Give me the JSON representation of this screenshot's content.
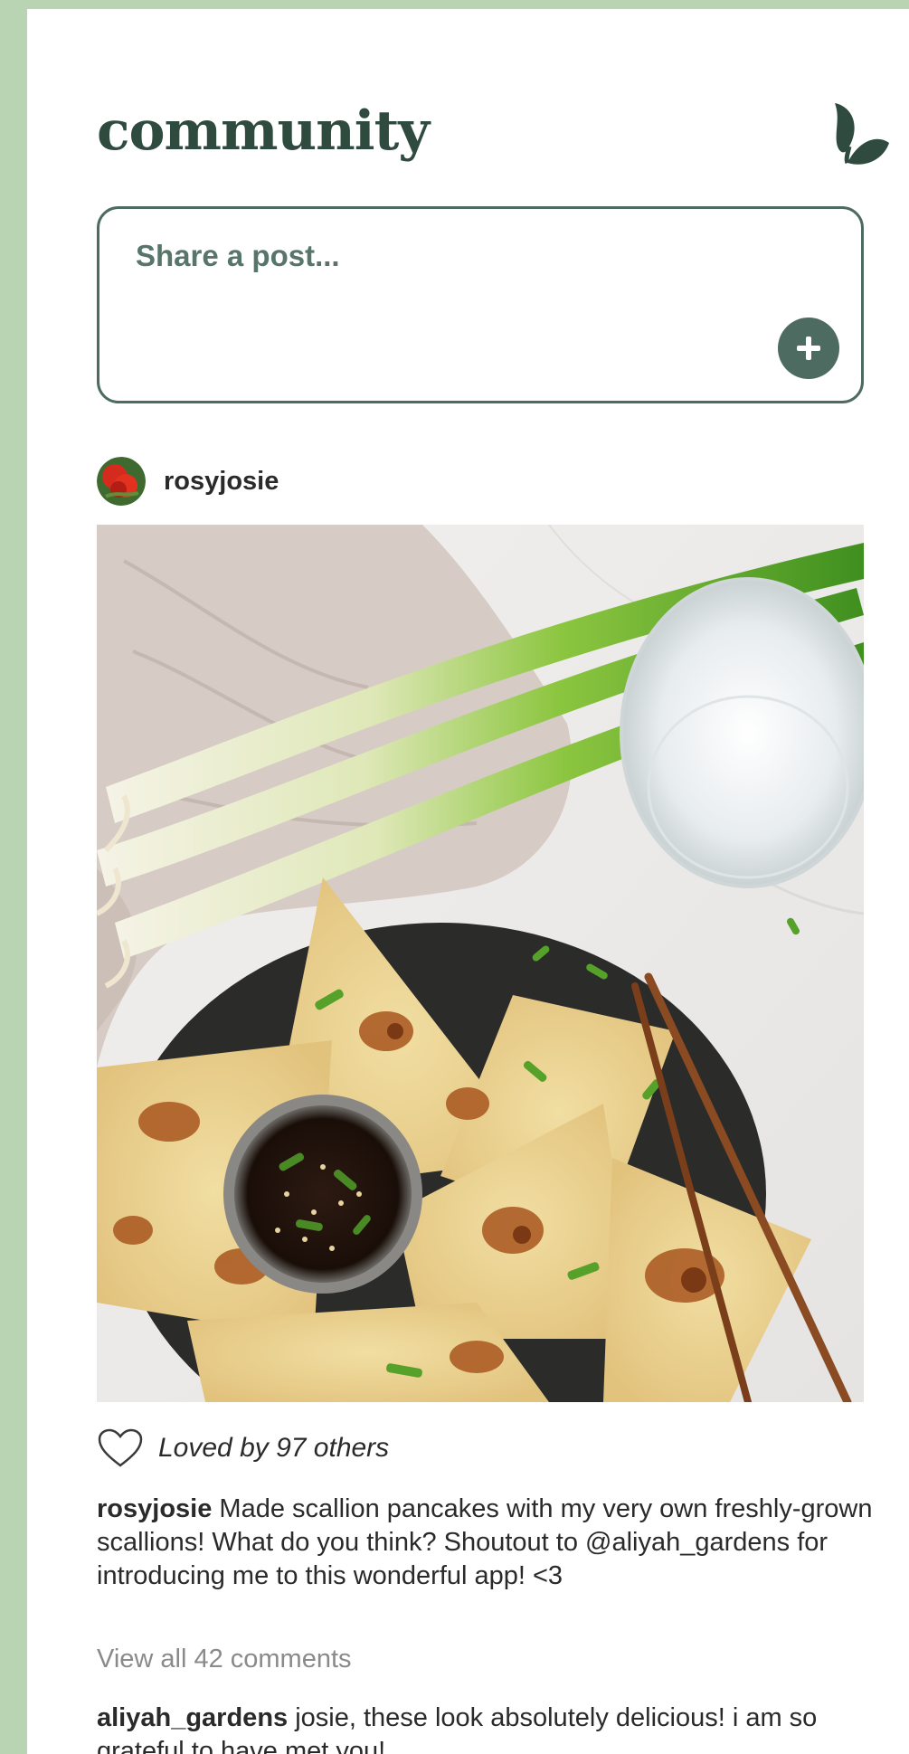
{
  "app": {
    "title": "community",
    "logo_icon": "sprout-icon",
    "accent_color": "#4d6b61"
  },
  "composer": {
    "placeholder": "Share a post...",
    "add_icon": "plus-icon"
  },
  "post": {
    "author": "rosyjosie",
    "image_subject": "scallion pancakes",
    "likes_text": "Loved by 97 others",
    "caption": "Made scallion pancakes with my very own freshly-grown scallions! What do you think? Shoutout to @aliyah_gardens for introducing me to this wonderful app! <3",
    "view_comments": "View all 42 comments",
    "comments": [
      {
        "author": "aliyah_gardens",
        "text": "josie, these look absolutely delicious! i am so grateful to have met you!"
      }
    ]
  }
}
